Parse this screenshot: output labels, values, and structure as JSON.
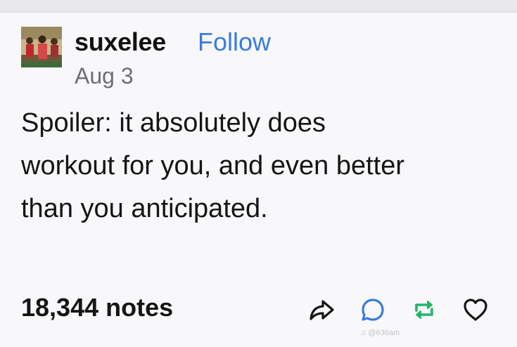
{
  "post": {
    "username": "suxelee",
    "follow_label": "Follow",
    "date": "Aug 3",
    "body_lines": [
      "Spoiler: it absolutely does",
      "workout for you, and even better",
      "than you anticipated."
    ],
    "notes": "18,344 notes"
  },
  "actions": [
    {
      "icon": "share-icon"
    },
    {
      "icon": "reply-icon"
    },
    {
      "icon": "reblog-icon"
    },
    {
      "icon": "like-icon"
    }
  ],
  "watermark": "@636am",
  "colors": {
    "follow": "#3a7be0",
    "reblog": "#26b46a",
    "text": "#151515",
    "date": "#6f6f73",
    "background": "#f8f8fa"
  }
}
